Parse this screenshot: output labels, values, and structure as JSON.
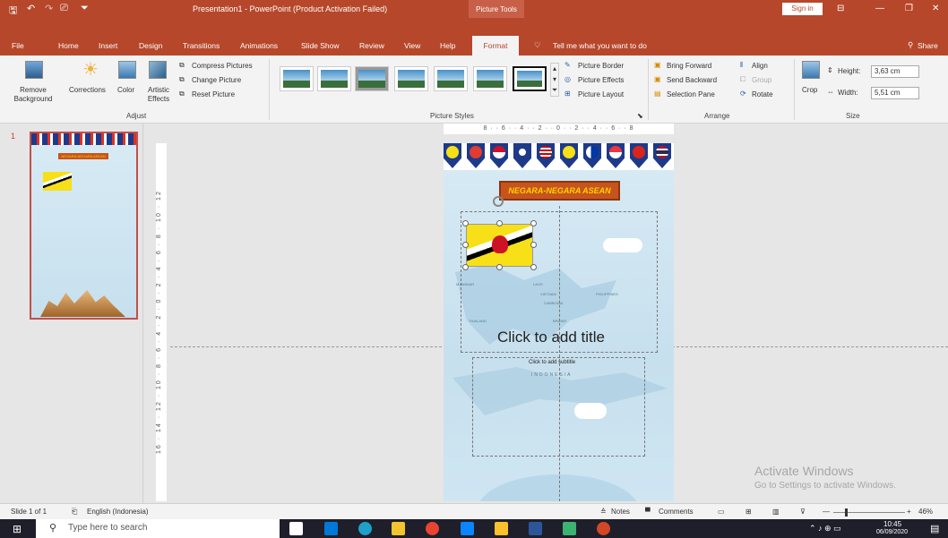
{
  "window": {
    "title": "Presentation1 - PowerPoint (Product Activation Failed)",
    "context_tab": "Picture Tools",
    "signin": "Sign in"
  },
  "tabs": [
    "File",
    "Home",
    "Insert",
    "Design",
    "Transitions",
    "Animations",
    "Slide Show",
    "Review",
    "View",
    "Help",
    "Format"
  ],
  "active_tab": "Format",
  "tellme": "Tell me what you want to do",
  "share": "Share",
  "ribbon": {
    "remove_bg": "Remove Background",
    "corrections": "Corrections",
    "color": "Color",
    "artistic": "Artistic Effects",
    "compress": "Compress Pictures",
    "change": "Change Picture",
    "reset": "Reset Picture",
    "group_adjust": "Adjust",
    "group_styles": "Picture Styles",
    "border": "Picture Border",
    "effects": "Picture Effects",
    "layout": "Picture Layout",
    "bring_forward": "Bring Forward",
    "send_backward": "Send Backward",
    "selection_pane": "Selection Pane",
    "align": "Align",
    "group": "Group",
    "rotate": "Rotate",
    "group_arrange": "Arrange",
    "crop": "Crop",
    "height_label": "Height:",
    "height_value": "3,63 cm",
    "width_label": "Width:",
    "width_value": "5,51 cm",
    "group_size": "Size"
  },
  "thumb": {
    "number": "1",
    "banner": "NEGARA-NEGARA ASEAN"
  },
  "slide": {
    "banner": "NEGARA-NEGARA ASEAN",
    "title_placeholder": "Click to add title",
    "subtitle_placeholder": "Click to add subtitle",
    "map_labels": [
      "MYANMAR",
      "LAOS",
      "VIETNAM",
      "PHILIPPINES",
      "CAMBODIA",
      "THAILAND",
      "BRUNEI",
      "INDONESIA"
    ]
  },
  "ruler_h": "8 · · 6 · · 4 · · 2 · · 0 · · 2 · · 4 · · 6 · · 8",
  "ruler_v": "16 · 14 · 12 · 10 · 8 · 6 · 4 · 2 · 0 · 2 · 4 · 6 · 8 · 10 · 12",
  "watermark": {
    "line1": "Activate Windows",
    "line2": "Go to Settings to activate Windows."
  },
  "status": {
    "slide": "Slide 1 of 1",
    "language": "English (Indonesia)",
    "notes": "Notes",
    "comments": "Comments",
    "zoom": "46%"
  },
  "taskbar": {
    "search": "Type here to search",
    "time": "10:45",
    "date": "06/09/2020"
  },
  "colors": {
    "accent": "#b7472a",
    "brunei_yellow": "#f7e017"
  }
}
